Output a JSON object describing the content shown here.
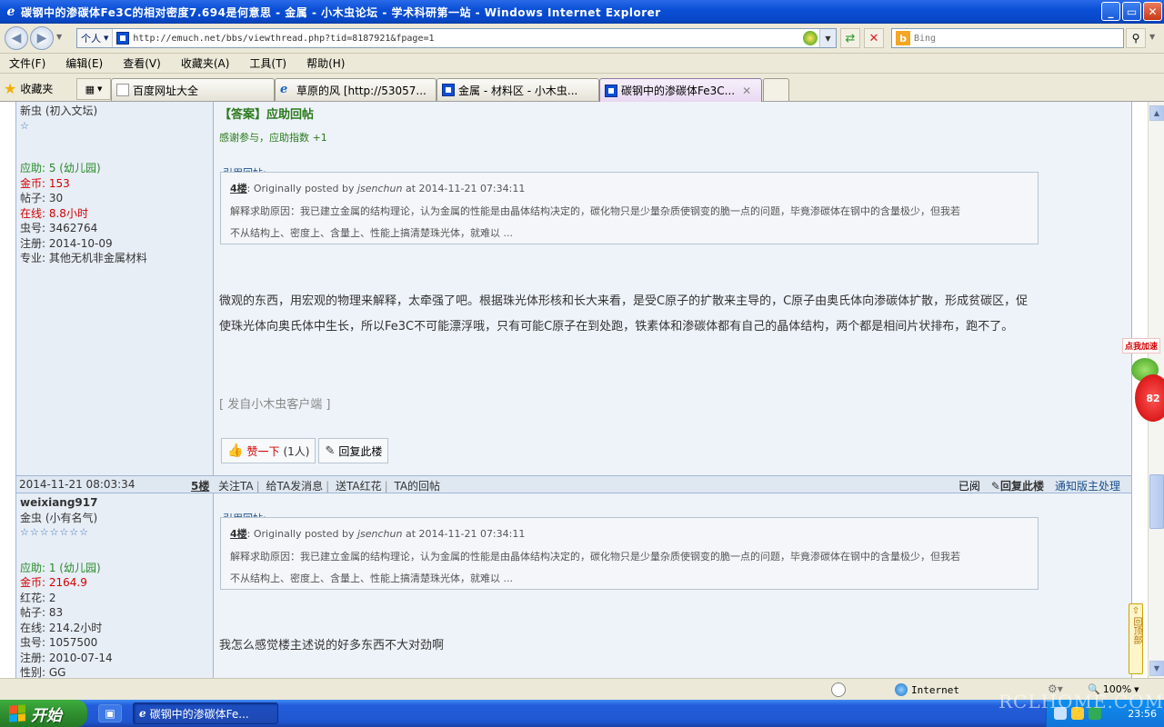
{
  "window": {
    "title": "碳钢中的渗碳体Fe3C的相对密度7.694是何意思 - 金属 - 小木虫论坛 - 学术科研第一站 - Windows Internet Explorer",
    "app_icon": "ie-icon",
    "min_label": "_",
    "max_label": "▭",
    "close_label": "✕"
  },
  "address": {
    "dropdown_label": "个人",
    "url": "http://emuch.net/bbs/viewthread.php?tid=8187921&fpage=1",
    "search_placeholder": "Bing"
  },
  "menu": [
    "文件(F)",
    "编辑(E)",
    "查看(V)",
    "收藏夹(A)",
    "工具(T)",
    "帮助(H)"
  ],
  "favorites_label": "收藏夹",
  "tabs": [
    {
      "label": "百度网址大全",
      "icon": "baidu-icon"
    },
    {
      "label": "草原的风 [http://53057...",
      "icon": "ie-icon"
    },
    {
      "label": "金属 - 材料区 - 小木虫...",
      "icon": "site-icon"
    },
    {
      "label": "碳钢中的渗碳体Fe3C...",
      "icon": "site-icon",
      "active": true
    }
  ],
  "post1": {
    "user_level": "新虫 (初入文坛)",
    "stars": "☆",
    "stats": [
      {
        "text": "应助: 5 (幼儿园)",
        "color": "green"
      },
      {
        "text": "金币: 153",
        "color": "red"
      },
      {
        "text": "帖子: 30",
        "color": "dark"
      },
      {
        "text": "在线: 8.8小时",
        "color": "red"
      },
      {
        "text": "虫号: 3462764",
        "color": "dark"
      },
      {
        "text": "注册: 2014-10-09",
        "color": "dark"
      },
      {
        "text": "专业: 其他无机非金属材料",
        "color": "dark"
      }
    ],
    "answer_title": "【答案】应助回帖",
    "answer_sub": "感谢参与，应助指数 +1",
    "quote_label": "引用回帖:",
    "quote_floor": "4楼",
    "quote_prefix": ": Originally posted by ",
    "quote_author": "jsenchun",
    "quote_time": " at 2014-11-21 07:34:11",
    "quote_line1": "解释求助原因：我已建立金属的结构理论，认为金属的性能是由晶体结构决定的，碳化物只是少量杂质使钢变的脆一点的问题，毕竟渗碳体在钢中的含量极少，但我若",
    "quote_line2": "不从结构上、密度上、含量上、性能上搞清楚珠光体，就难以 ...",
    "body": "微观的东西，用宏观的物理来解释，太牵强了吧。根据珠光体形核和长大来看，是受C原子的扩散来主导的，C原子由奥氏体向渗碳体扩散，形成贫碳区，促使珠光体向奥氏体中生长，所以Fe3C不可能漂浮哦，只有可能C原子在到处跑，铁素体和渗碳体都有自己的晶体结构，两个都是相间片状排布，跑不了。",
    "from_client": "[ 发自小木虫客户端 ]",
    "like_label": "赞一下",
    "like_count": "(1人)",
    "reply_label": "回复此楼",
    "footer_date": "2014-11-21 08:03:34",
    "footer_floor": "5楼",
    "footer_links": [
      "关注TA",
      "给TA发消息",
      "送TA红花",
      "TA的回帖"
    ],
    "footer_read": "已阅",
    "footer_reply": "回复此楼",
    "footer_notify": "通知版主处理"
  },
  "post2": {
    "username": "weixiang917",
    "user_level": "金虫 (小有名气)",
    "stars": "☆☆☆☆☆☆☆",
    "stats": [
      {
        "text": "应助: 1 (幼儿园)",
        "color": "green"
      },
      {
        "text": "金币: 2164.9",
        "color": "red"
      },
      {
        "text": "红花: 2",
        "color": "dark"
      },
      {
        "text": "帖子: 83",
        "color": "dark"
      },
      {
        "text": "在线: 214.2小时",
        "color": "dark"
      },
      {
        "text": "虫号: 1057500",
        "color": "dark"
      },
      {
        "text": "注册: 2010-07-14",
        "color": "dark"
      },
      {
        "text": "性别: GG",
        "color": "dark"
      }
    ],
    "quote_label": "引用回帖:",
    "quote_floor": "4楼",
    "quote_prefix": ": Originally posted by ",
    "quote_author": "jsenchun",
    "quote_time": " at 2014-11-21 07:34:11",
    "quote_line1": "解释求助原因：我已建立金属的结构理论，认为金属的性能是由晶体结构决定的，碳化物只是少量杂质使钢变的脆一点的问题，毕竟渗碳体在钢中的含量极少，但我若",
    "quote_line2": "不从结构上、密度上、含量上、性能上搞清楚珠光体，就难以 ...",
    "body": "我怎么感觉楼主述说的好多东西不大对劲啊"
  },
  "floating": {
    "ad_label": "点我加速",
    "ad_number": "82",
    "backtop_label": "回顶部"
  },
  "status": {
    "zone": "Internet",
    "zoom": "100%"
  },
  "taskbar": {
    "start_label": "开始",
    "task_label": "碳钢中的渗碳体Fe...",
    "clock": "23:56",
    "watermark": "RCLHOME.COM"
  }
}
